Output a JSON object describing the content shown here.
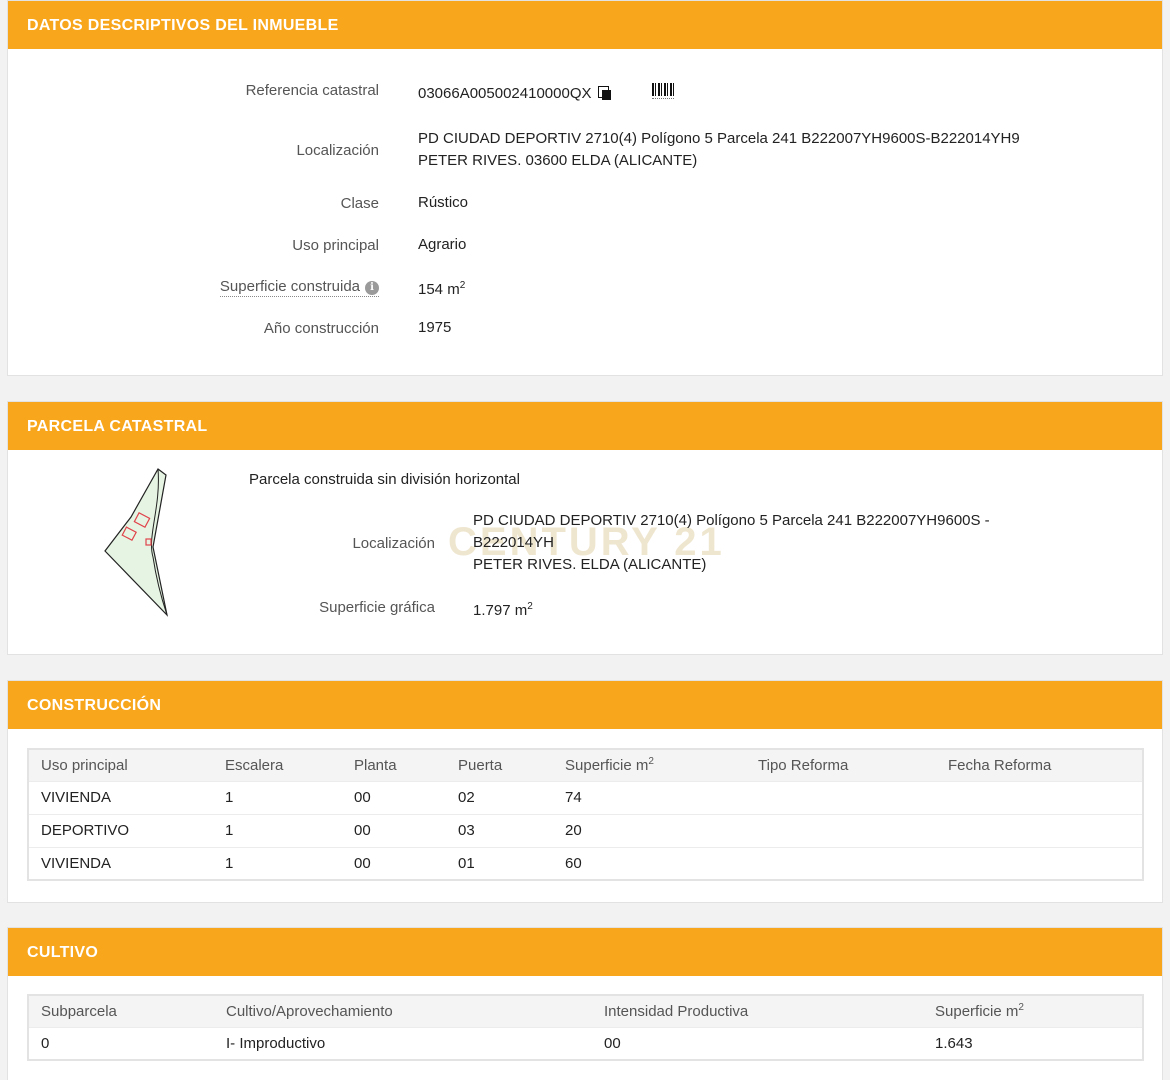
{
  "inmueble": {
    "title": "DATOS DESCRIPTIVOS DEL INMUEBLE",
    "referencia_label": "Referencia catastral",
    "referencia_value": "03066A005002410000QX",
    "localizacion_label": "Localización",
    "localizacion_line1": "PD CIUDAD DEPORTIV 2710(4) Polígono 5 Parcela 241 B222007YH9600S-B222014YH9",
    "localizacion_line2": "PETER RIVES. 03600 ELDA (ALICANTE)",
    "clase_label": "Clase",
    "clase_value": "Rústico",
    "uso_label": "Uso principal",
    "uso_value": "Agrario",
    "superficie_label": "Superficie construida",
    "superficie_value": "154 m",
    "superficie_unit_sup": "2",
    "anio_label": "Año construcción",
    "anio_value": "1975",
    "info_glyph": "i"
  },
  "parcela": {
    "title": "PARCELA CATASTRAL",
    "descripcion": "Parcela construida sin división horizontal",
    "localizacion_label": "Localización",
    "localizacion_line1": "PD CIUDAD DEPORTIV 2710(4) Polígono 5 Parcela 241 B222007YH9600S -",
    "localizacion_line2": "B222014YH",
    "localizacion_line3": "PETER RIVES. ELDA (ALICANTE)",
    "superficie_label": "Superficie gráfica",
    "superficie_value": "1.797 m",
    "superficie_unit_sup": "2",
    "watermark": "CENTURY 21"
  },
  "construccion": {
    "title": "CONSTRUCCIÓN",
    "headers": [
      "Uso principal",
      "Escalera",
      "Planta",
      "Puerta",
      "Superficie m",
      "Tipo Reforma",
      "Fecha Reforma"
    ],
    "header_sup": "2",
    "rows": [
      [
        "VIVIENDA",
        "1",
        "00",
        "02",
        "74",
        "",
        ""
      ],
      [
        "DEPORTIVO",
        "1",
        "00",
        "03",
        "20",
        "",
        ""
      ],
      [
        "VIVIENDA",
        "1",
        "00",
        "01",
        "60",
        "",
        ""
      ]
    ]
  },
  "cultivo": {
    "title": "CULTIVO",
    "headers": [
      "Subparcela",
      "Cultivo/Aprovechamiento",
      "Intensidad Productiva",
      "Superficie m"
    ],
    "header_sup": "2",
    "rows": [
      [
        "0",
        "I- Improductivo",
        "00",
        "1.643"
      ]
    ]
  },
  "colors": {
    "header_bg": "#f8a61c",
    "parcel_fill": "#e6f5e3",
    "building_outline": "#e0434b"
  },
  "icons": [
    "copy-icon",
    "barcode-icon",
    "info-icon",
    "parcel-map"
  ]
}
